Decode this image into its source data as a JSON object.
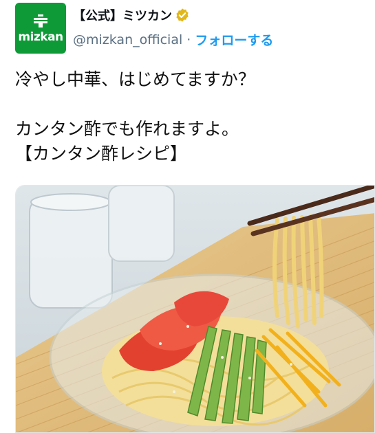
{
  "account": {
    "logo_text": "mizkan",
    "display_name": "【公式】ミツカン",
    "handle": "@mizkan_official",
    "separator": "·",
    "follow_label": "フォローする",
    "brand_color": "#0e9a37",
    "verified_color": "#e2b719",
    "follow_color": "#1d9bf0"
  },
  "tweet": {
    "lines": [
      "冷やし中華、はじめてますか？",
      "カンタン酢でも作れますよ。",
      "【カンタン酢レシピ】"
    ]
  },
  "media": {
    "icon": "photo-cold-ramen"
  }
}
